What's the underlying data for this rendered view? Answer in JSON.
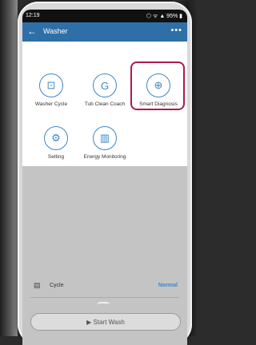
{
  "status": {
    "time": "12:19",
    "right": "⬡ ᯤ ▲ 95% ▮"
  },
  "header": {
    "title": "Washer",
    "more": "•••"
  },
  "tiles": [
    {
      "label": "Washer Cycle",
      "icon": "washer-cycle-icon",
      "glyph": "⊡"
    },
    {
      "label": "Tub Clean Coach",
      "icon": "tub-clean-icon",
      "glyph": "G"
    },
    {
      "label": "Smart Diagnosis",
      "icon": "smart-diagnosis-icon",
      "glyph": "⊕"
    },
    {
      "label": "Setting",
      "icon": "gear-icon",
      "glyph": "⚙"
    },
    {
      "label": "Energy Monitoring",
      "icon": "energy-icon",
      "glyph": "▥"
    }
  ],
  "cycle": {
    "label": "Cycle",
    "value": "Normal"
  },
  "start": {
    "label": "▶ Start Wash"
  },
  "colors": {
    "accent": "#3f86c4",
    "highlight": "#b0194a",
    "appbar": "#2f6fa7"
  }
}
